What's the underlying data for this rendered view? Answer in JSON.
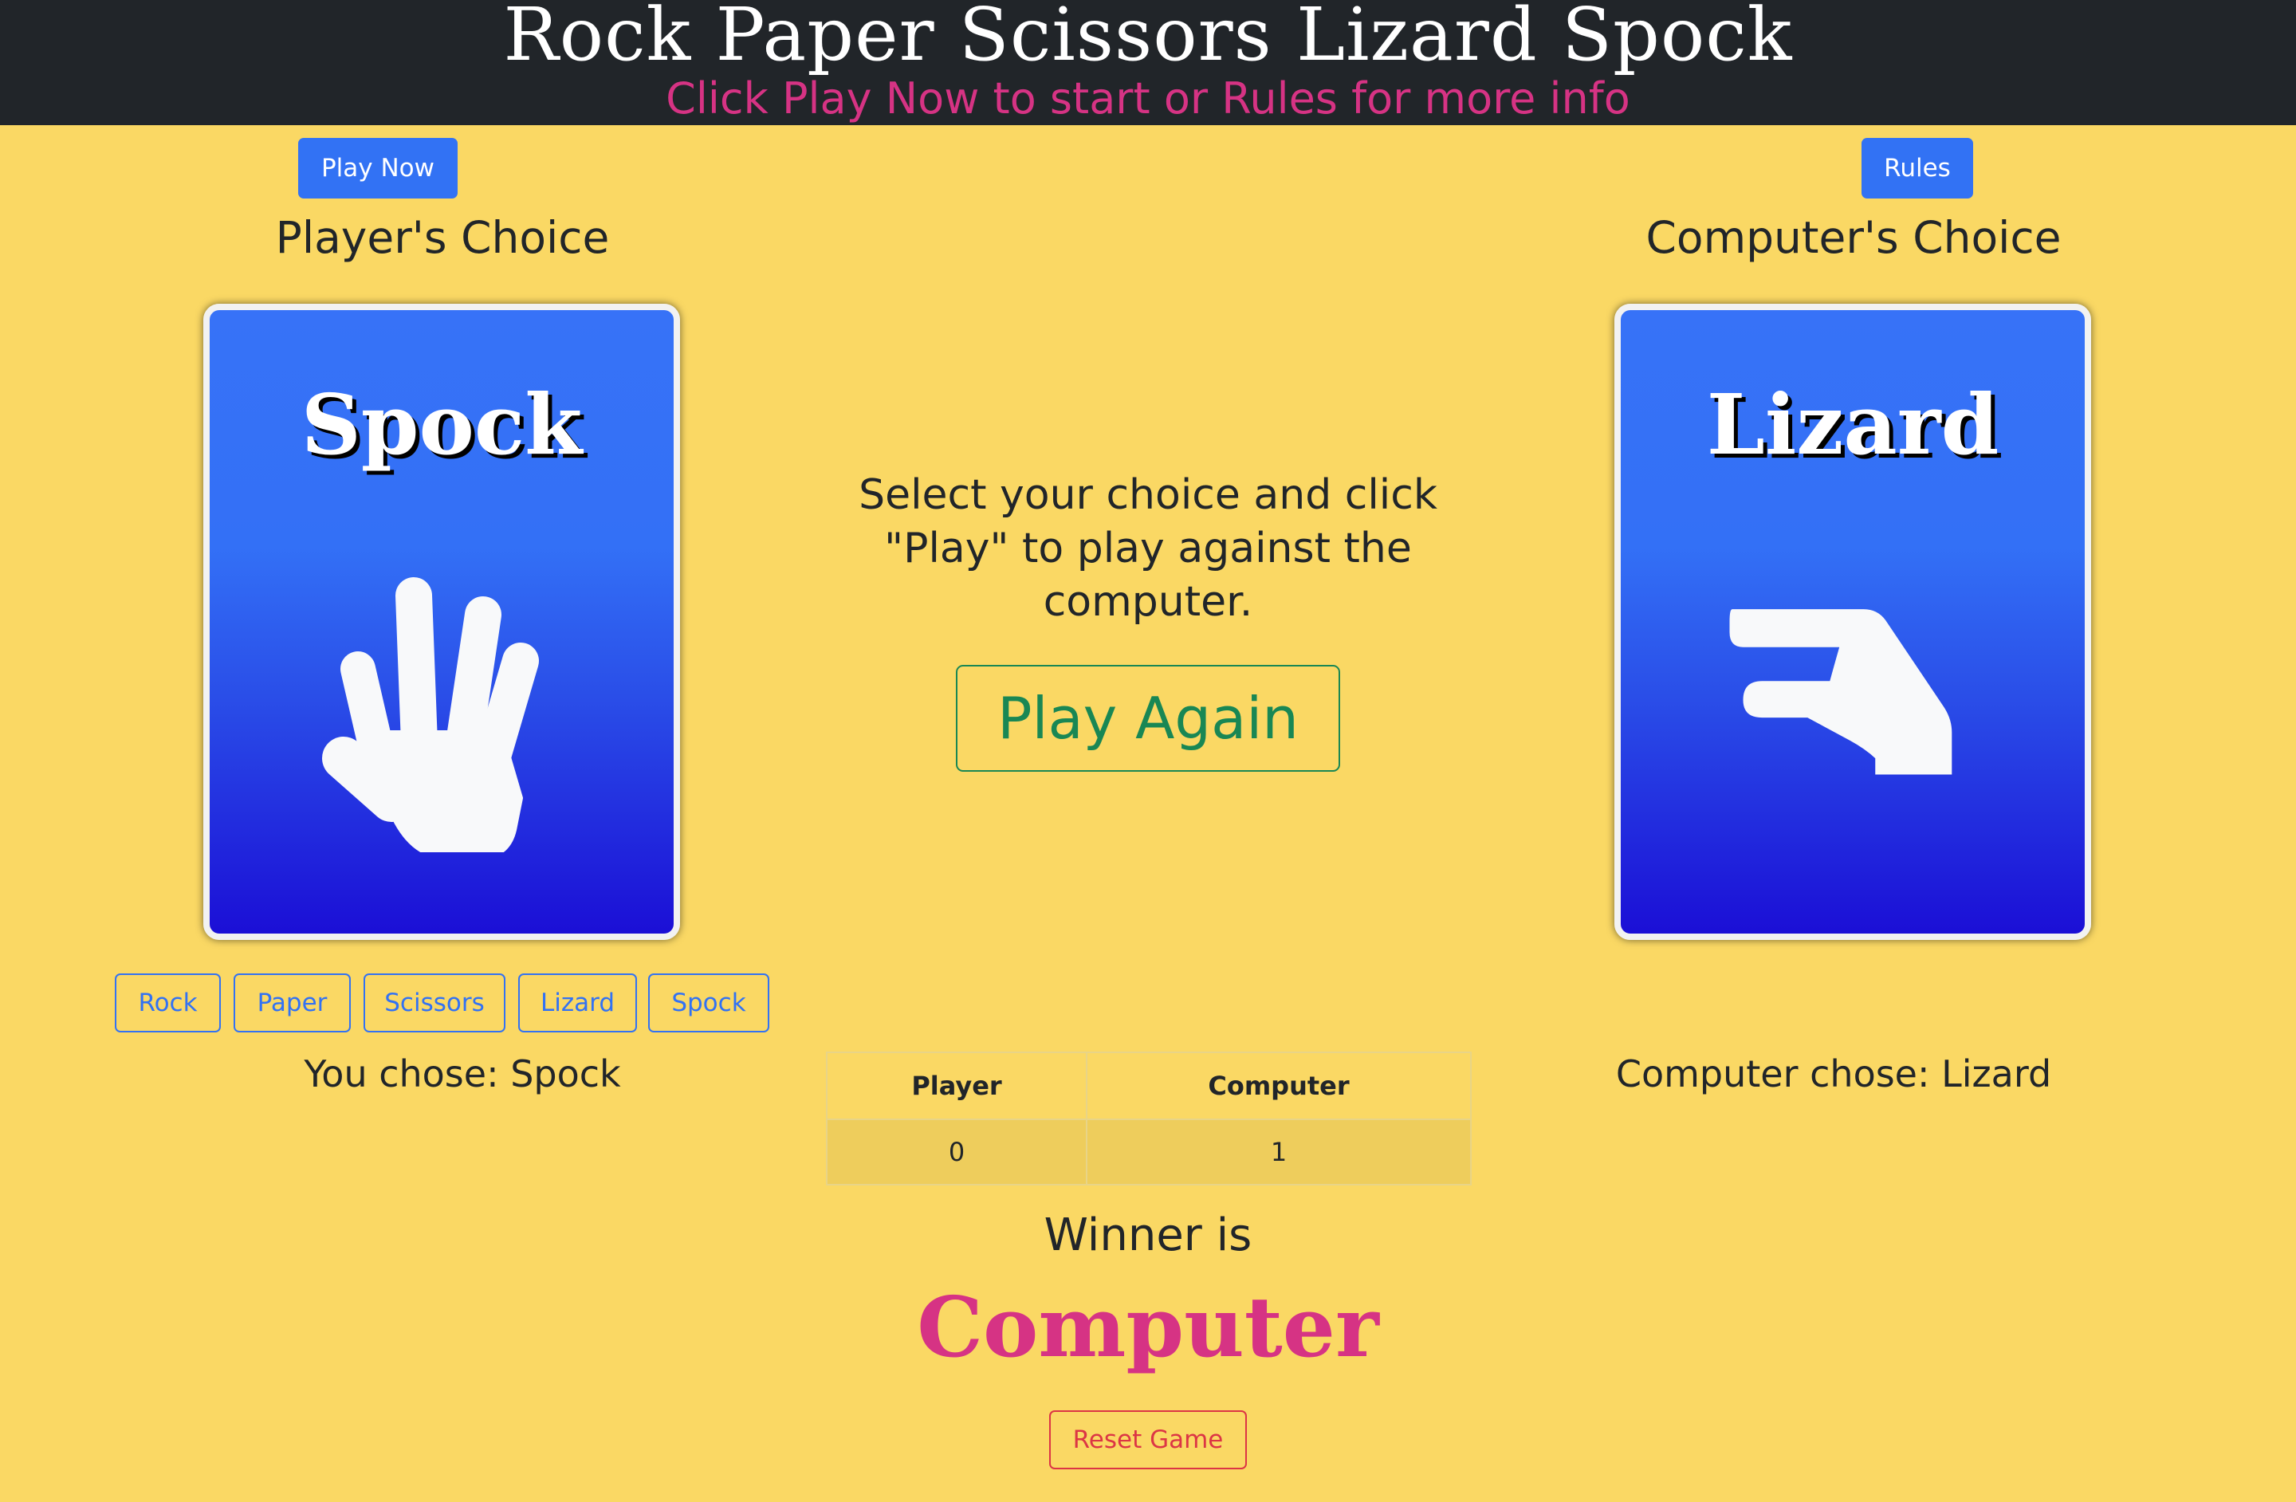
{
  "header": {
    "title": "Rock Paper Scissors Lizard Spock",
    "subtitle": "Click Play Now to start or Rules for more info"
  },
  "toolbar": {
    "play_now_label": "Play Now",
    "rules_label": "Rules"
  },
  "player": {
    "heading": "Player's Choice",
    "card_title": "Spock",
    "card_icon": "spock-hand-icon",
    "chose_text": "You chose: Spock",
    "choices": [
      "Rock",
      "Paper",
      "Scissors",
      "Lizard",
      "Spock"
    ]
  },
  "computer": {
    "heading": "Computer's Choice",
    "card_title": "Lizard",
    "card_icon": "lizard-hand-icon",
    "chose_text": "Computer chose: Lizard"
  },
  "center": {
    "instructions": "Select your choice and click \"Play\" to play against the computer.",
    "play_again_label": "Play Again"
  },
  "score": {
    "headers": [
      "Player",
      "Computer"
    ],
    "values": [
      "0",
      "1"
    ]
  },
  "winner": {
    "label": "Winner is",
    "name": "Computer"
  },
  "reset_label": "Reset Game",
  "colors": {
    "background": "#fad864",
    "header_bg": "#212529",
    "accent_pink": "#d63384",
    "primary_blue": "#3272f4",
    "success_green": "#198754",
    "danger_red": "#dc3545"
  }
}
